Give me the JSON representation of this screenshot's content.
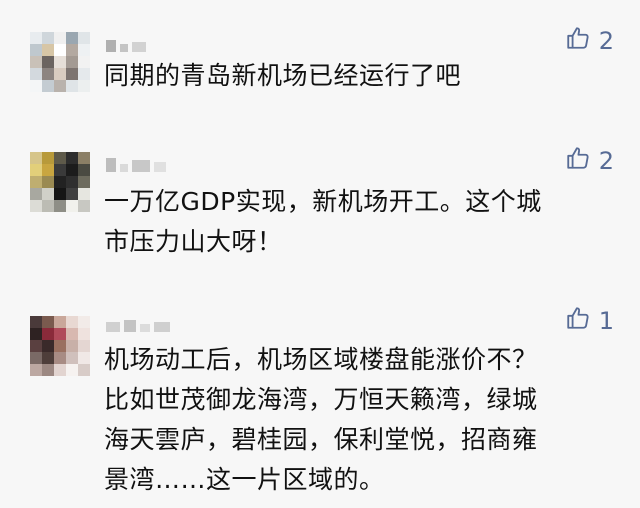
{
  "comments": [
    {
      "text": "同期的青岛新机场已经运行了吧",
      "likes": "2",
      "like_icon": "thumbs-up-icon",
      "avatar_palette": [
        "#e8ecef",
        "#cfd6db",
        "#f0f0f0",
        "#9aa7b1",
        "#e0e5e8",
        "#bfc8ce",
        "#d7c6a6",
        "#ffffff",
        "#b3a9a1",
        "#eef1f3",
        "#c9c1b8",
        "#6b6460",
        "#e6dfd8",
        "#a39a93",
        "#f2f2f2",
        "#d3d9de",
        "#8c8480",
        "#d9ccc0",
        "#7d7470",
        "#e5e9ec",
        "#f4f6f7",
        "#c4ccd2",
        "#b9b2ac",
        "#dfe4e7",
        "#ecefef"
      ]
    },
    {
      "text": "一万亿GDP实现，新机场开工。这个城\n市压力山大呀！",
      "likes": "2",
      "like_icon": "thumbs-up-icon",
      "avatar_palette": [
        "#d6c58a",
        "#b89a3a",
        "#5e5a4a",
        "#2d2d2d",
        "#8b7f66",
        "#e2cf7a",
        "#c9a640",
        "#3a3a3a",
        "#1c1c1c",
        "#4a4a42",
        "#bfae70",
        "#9a8a52",
        "#222222",
        "#2f2f2f",
        "#6d6b5e",
        "#a8a8a0",
        "#d0d0c8",
        "#151515",
        "#404040",
        "#e6e6e0",
        "#dcdcd6",
        "#bcbcb4",
        "#8e8e86",
        "#f1f1ec",
        "#c8c8c2"
      ]
    },
    {
      "text": "机场动工后，机场区域楼盘能涨价不？\n比如世茂御龙海湾，万恒天籁湾，绿城\n海天雲庐，碧桂园，保利堂悦，招商雍\n景湾……这一片区域的。",
      "likes": "1",
      "like_icon": "thumbs-up-icon",
      "avatar_palette": [
        "#4a3a3a",
        "#7a5a4e",
        "#c9a79a",
        "#e8d8d2",
        "#f2ebe8",
        "#2e2222",
        "#8a2a3a",
        "#b04a5a",
        "#d8b8b0",
        "#efe2de",
        "#5a4040",
        "#3a2a2a",
        "#9a7060",
        "#c8b0a8",
        "#e4d6d2",
        "#7a6a66",
        "#4e3e3a",
        "#a88c84",
        "#d0c0bc",
        "#f0e8e6",
        "#bca8a2",
        "#9c8882",
        "#e2d4d0",
        "#f6f2f0",
        "#d8ccc8"
      ]
    }
  ]
}
